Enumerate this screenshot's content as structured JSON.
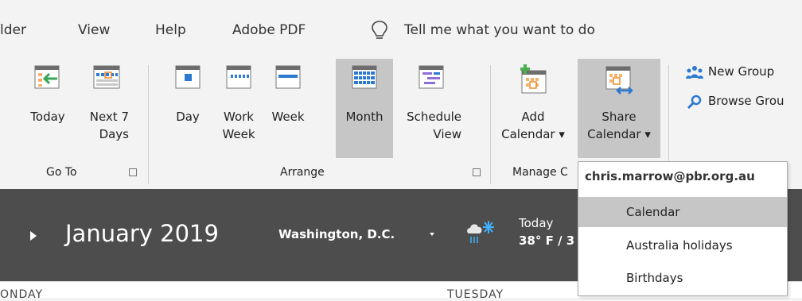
{
  "tabs": [
    "lder",
    "View",
    "Help",
    "Adobe PDF"
  ],
  "tell_me": "Tell me what you want to do",
  "ribbon": {
    "goto": {
      "today": "Today",
      "next7": "Next 7\nDays",
      "group_label": "Go To"
    },
    "arrange": {
      "day": "Day",
      "work_week": "Work\nWeek",
      "week": "Week",
      "month": "Month",
      "schedule_view": "Schedule\nView",
      "group_label": "Arrange"
    },
    "manage": {
      "add_calendar": "Add\nCalendar ▾",
      "share_calendar": "Share\nCalendar ▾",
      "group_label": "Manage C"
    },
    "groups": {
      "new_group": "New Group",
      "browse_groups": "Browse Grou"
    }
  },
  "header": {
    "month": "January 2019",
    "location": "Washington, D.C.",
    "today_label": "Today",
    "temperature": "38° F / 3"
  },
  "day_headers": [
    "ONDAY",
    "TUESDAY"
  ],
  "share_dropdown": {
    "account": "chris.marrow@pbr.org.au",
    "items": [
      "Calendar",
      "Australia holidays",
      "Birthdays"
    ],
    "selected_index": 0
  },
  "colors": {
    "accent": "#2b79d0",
    "add_green": "#4caf50",
    "header_bg": "#4d4d4d",
    "pressed_bg": "#c6c6c6"
  }
}
